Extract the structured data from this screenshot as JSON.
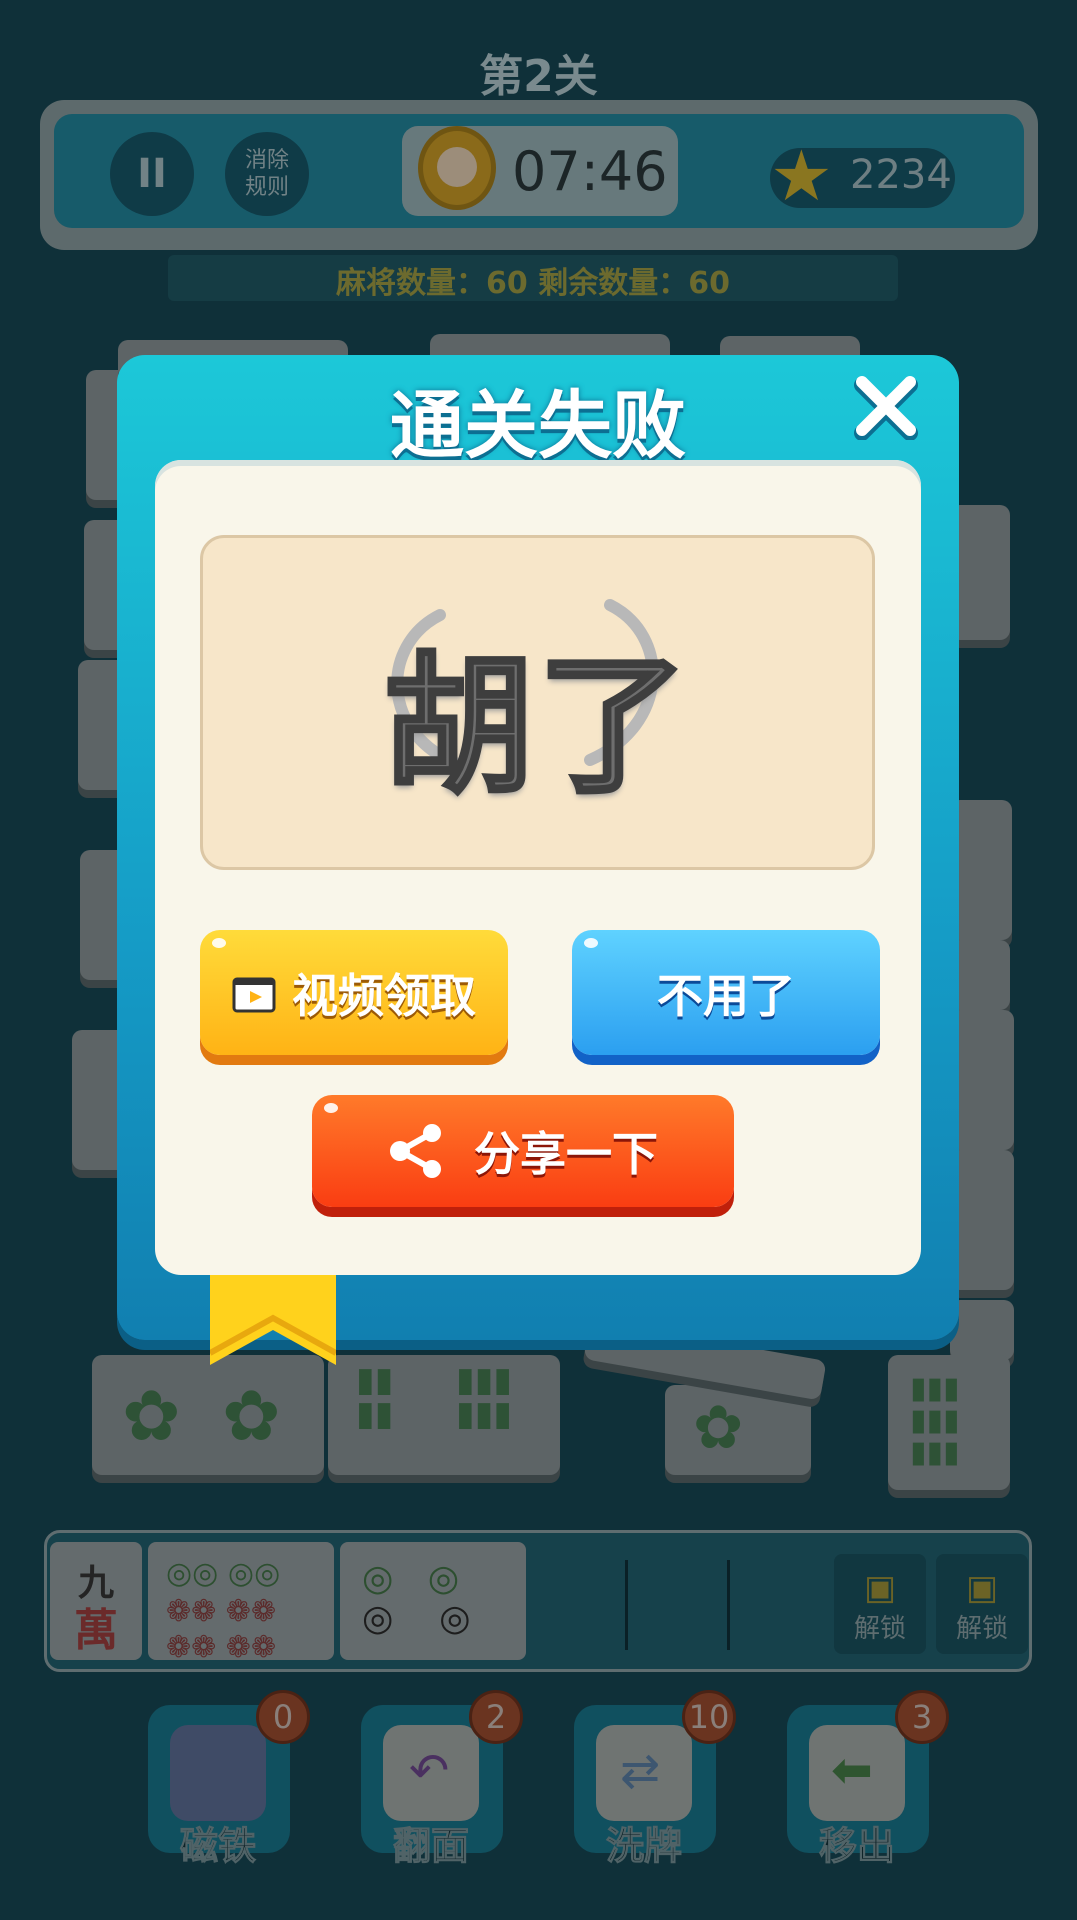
{
  "header": {
    "level_title": "第2关",
    "pause_icon": "II",
    "rules_label_1": "消除",
    "rules_label_2": "规则",
    "timer": "07:46",
    "stars": "2234",
    "tile_count": "麻将数量：60    剩余数量：60"
  },
  "modal": {
    "title": "通关失败",
    "close_icon": "close-icon",
    "result_text": "胡了",
    "video_button": "视频领取",
    "no_button": "不用了",
    "share_button": "分享一下"
  },
  "tray": {
    "slot_1_top": "九",
    "slot_1_bottom": "萬",
    "unlock_1": "解锁",
    "unlock_2": "解锁"
  },
  "tools": [
    {
      "label": "磁铁",
      "count": "0",
      "icon": "magnet-icon"
    },
    {
      "label": "翻面",
      "count": "2",
      "icon": "flip-icon"
    },
    {
      "label": "洗牌",
      "count": "10",
      "icon": "shuffle-icon"
    },
    {
      "label": "移出",
      "count": "3",
      "icon": "move-out-icon"
    }
  ],
  "colors": {
    "background": "#0f3039",
    "modal": "#159bc6",
    "video_button": "#ffc21f",
    "no_button": "#2b9ff0",
    "share_button": "#fa3d12"
  }
}
